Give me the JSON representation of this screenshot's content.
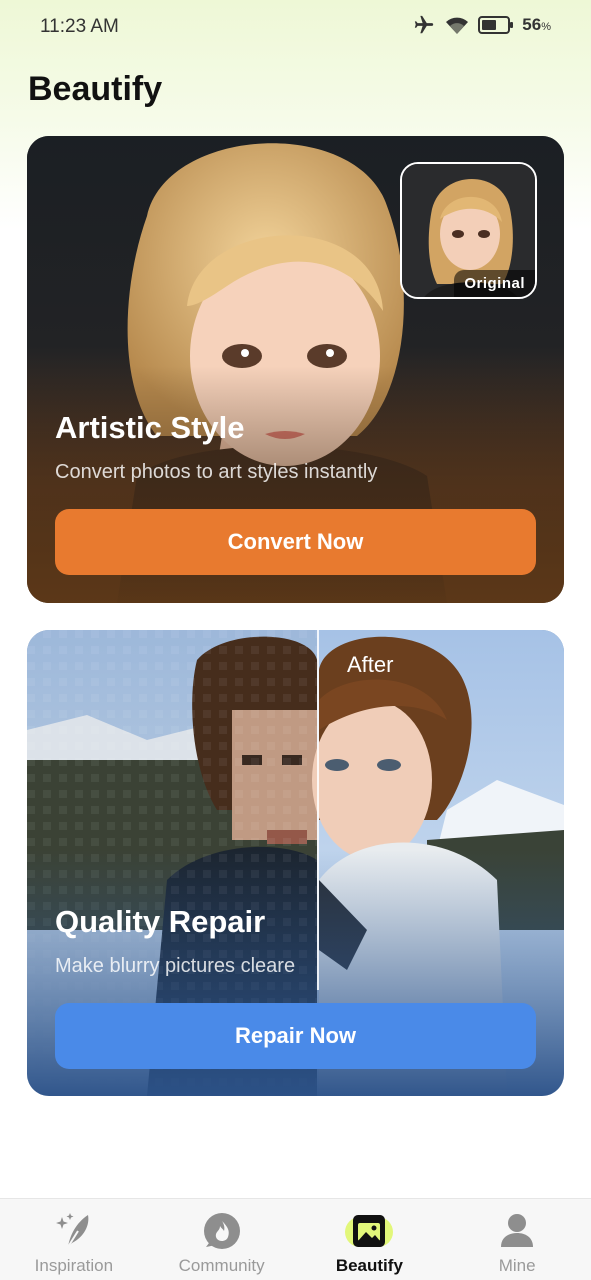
{
  "status_bar": {
    "time": "11:23 AM",
    "battery_percent": "56",
    "battery_unit": "%",
    "icons": [
      "airplane-icon",
      "wifi-icon",
      "battery-icon"
    ]
  },
  "page": {
    "title": "Beautify"
  },
  "artistic_card": {
    "title": "Artistic Style",
    "subtitle": "Convert photos to art styles instantly",
    "button_label": "Convert Now",
    "thumbnail_label": "Original",
    "accent_color": "#e87a2f"
  },
  "repair_card": {
    "title": "Quality Repair",
    "subtitle": "Make blurry pictures cleare",
    "button_label": "Repair Now",
    "after_label": "After",
    "accent_color": "#4a8ae8"
  },
  "tab_bar": {
    "tabs": [
      {
        "label": "Inspiration",
        "icon": "feather-sparkle-icon",
        "active": false
      },
      {
        "label": "Community",
        "icon": "flame-chat-icon",
        "active": false
      },
      {
        "label": "Beautify",
        "icon": "image-icon",
        "active": true
      },
      {
        "label": "Mine",
        "icon": "person-icon",
        "active": false
      }
    ]
  }
}
